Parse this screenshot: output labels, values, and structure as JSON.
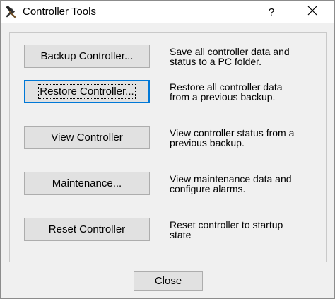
{
  "window": {
    "title": "Controller Tools",
    "help_glyph": "?",
    "icon": "hammer-wrench-icon"
  },
  "actions": [
    {
      "label": "Backup Controller...",
      "desc_line1": "Save all controller data and",
      "desc_line2": "status to a PC folder."
    },
    {
      "label": "Restore Controller...",
      "desc_line1": "Restore all controller data",
      "desc_line2": "from a previous backup.",
      "focused": true
    },
    {
      "label": "View Controller",
      "desc_line1": "View controller status from a",
      "desc_line2": "previous backup."
    },
    {
      "label": "Maintenance...",
      "desc_line1": "View maintenance data and",
      "desc_line2": "configure alarms."
    },
    {
      "label": "Reset Controller",
      "desc_line1": "Reset controller to startup",
      "desc_line2": "state"
    }
  ],
  "footer": {
    "close_label": "Close"
  },
  "colors": {
    "dialog_bg": "#f0f0f0",
    "button_bg": "#e1e1e1",
    "focus_border": "#0078d7"
  }
}
